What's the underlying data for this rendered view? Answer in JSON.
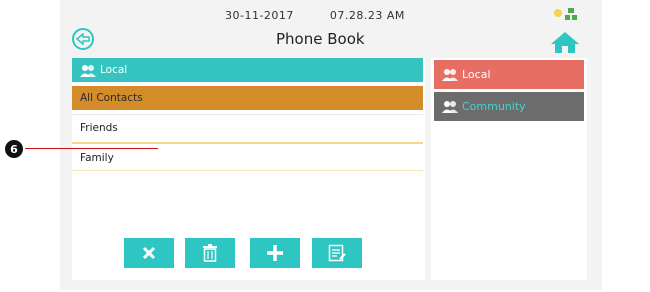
{
  "status": {
    "date": "30-11-2017",
    "time": "07.28.23 AM"
  },
  "header": {
    "title": "Phone Book"
  },
  "contacts_panel": {
    "header_label": "Local",
    "rows": [
      "All Contacts",
      "Friends",
      "Family"
    ]
  },
  "tabs": {
    "local_label": "Local",
    "community_label": "Community"
  },
  "toolbar": {
    "cancel_icon": "close-icon",
    "delete_icon": "trash-icon",
    "add_icon": "plus-icon",
    "edit_icon": "edit-list-icon"
  },
  "callout": {
    "number": "6"
  },
  "colors": {
    "accent": "#2ec6c2",
    "selected_row": "#d48c2a",
    "local_tab": "#e76e62",
    "community_tab": "#6c6c6c"
  }
}
